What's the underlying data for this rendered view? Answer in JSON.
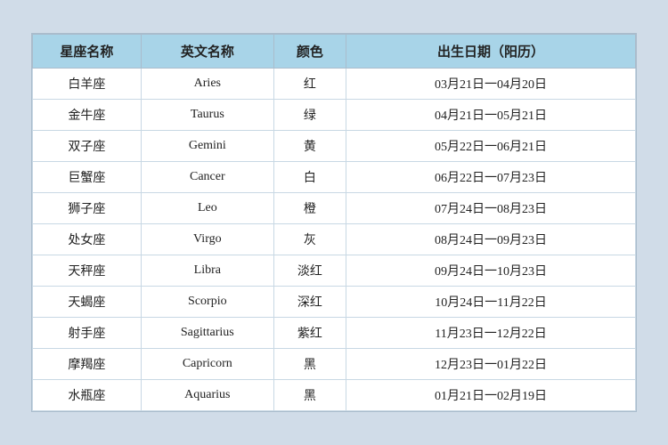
{
  "table": {
    "headers": {
      "col1": "星座名称",
      "col2": "英文名称",
      "col3": "颜色",
      "col4": "出生日期（阳历）"
    },
    "rows": [
      {
        "cn": "白羊座",
        "en": "Aries",
        "color": "红",
        "date": "03月21日一04月20日"
      },
      {
        "cn": "金牛座",
        "en": "Taurus",
        "color": "绿",
        "date": "04月21日一05月21日"
      },
      {
        "cn": "双子座",
        "en": "Gemini",
        "color": "黄",
        "date": "05月22日一06月21日"
      },
      {
        "cn": "巨蟹座",
        "en": "Cancer",
        "color": "白",
        "date": "06月22日一07月23日"
      },
      {
        "cn": "狮子座",
        "en": "Leo",
        "color": "橙",
        "date": "07月24日一08月23日"
      },
      {
        "cn": "处女座",
        "en": "Virgo",
        "color": "灰",
        "date": "08月24日一09月23日"
      },
      {
        "cn": "天秤座",
        "en": "Libra",
        "color": "淡红",
        "date": "09月24日一10月23日"
      },
      {
        "cn": "天蝎座",
        "en": "Scorpio",
        "color": "深红",
        "date": "10月24日一11月22日"
      },
      {
        "cn": "射手座",
        "en": "Sagittarius",
        "color": "紫红",
        "date": "11月23日一12月22日"
      },
      {
        "cn": "摩羯座",
        "en": "Capricorn",
        "color": "黑",
        "date": "12月23日一01月22日"
      },
      {
        "cn": "水瓶座",
        "en": "Aquarius",
        "color": "黑",
        "date": "01月21日一02月19日"
      }
    ]
  }
}
